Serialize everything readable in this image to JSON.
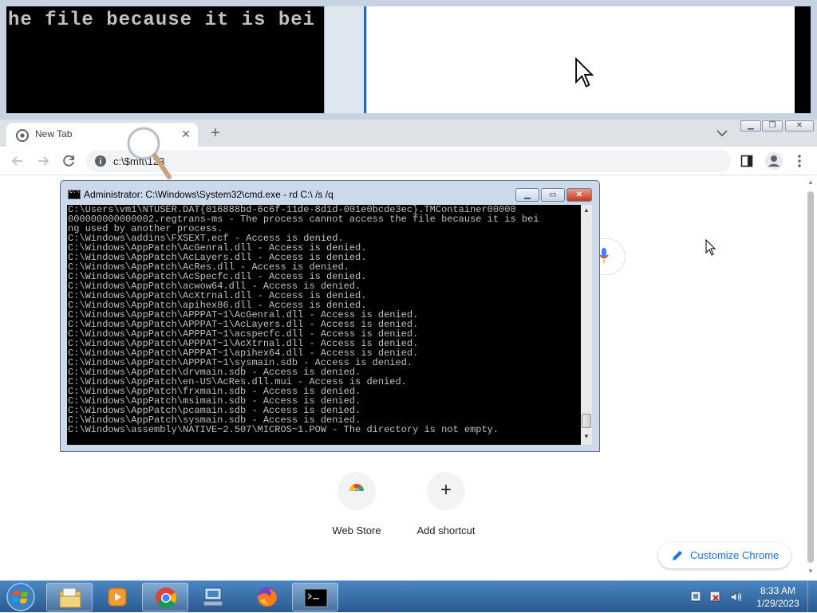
{
  "background_window": {
    "console_text": "he file because it is bei"
  },
  "chrome": {
    "tab_title": "New Tab",
    "address": "c:\\$mft\\123",
    "shortcuts": [
      {
        "label": "Web Store",
        "icon": "webstore-icon"
      },
      {
        "label": "Add shortcut",
        "icon": "add-icon"
      }
    ],
    "customize_label": "Customize Chrome",
    "accent_color": "#1a73e8"
  },
  "cmd": {
    "title": "Administrator: C:\\Windows\\System32\\cmd.exe - rd  C:\\ /s /q",
    "lines": [
      "C:\\Users\\vm1\\NTUSER.DAT{016888bd-6c6f-11de-8d1d-001e0bcde3ec}.TMContainer00000",
      "000000000000002.regtrans-ms - The process cannot access the file because it is bei",
      "ng used by another process.",
      "C:\\Windows\\addins\\FXSEXT.ecf - Access is denied.",
      "C:\\Windows\\AppPatch\\AcGenral.dll - Access is denied.",
      "C:\\Windows\\AppPatch\\AcLayers.dll - Access is denied.",
      "C:\\Windows\\AppPatch\\AcRes.dll - Access is denied.",
      "C:\\Windows\\AppPatch\\AcSpecfc.dll - Access is denied.",
      "C:\\Windows\\AppPatch\\acwow64.dll - Access is denied.",
      "C:\\Windows\\AppPatch\\AcXtrnal.dll - Access is denied.",
      "C:\\Windows\\AppPatch\\apihex86.dll - Access is denied.",
      "C:\\Windows\\AppPatch\\APPPAT~1\\AcGenral.dll - Access is denied.",
      "C:\\Windows\\AppPatch\\APPPAT~1\\AcLayers.dll - Access is denied.",
      "C:\\Windows\\AppPatch\\APPPAT~1\\acspecfc.dll - Access is denied.",
      "C:\\Windows\\AppPatch\\APPPAT~1\\AcXtrnal.dll - Access is denied.",
      "C:\\Windows\\AppPatch\\APPPAT~1\\apihex64.dll - Access is denied.",
      "C:\\Windows\\AppPatch\\APPPAT~1\\sysmain.sdb - Access is denied.",
      "C:\\Windows\\AppPatch\\drvmain.sdb - Access is denied.",
      "C:\\Windows\\AppPatch\\en-US\\AcRes.dll.mui - Access is denied.",
      "C:\\Windows\\AppPatch\\frxmain.sdb - Access is denied.",
      "C:\\Windows\\AppPatch\\msimain.sdb - Access is denied.",
      "C:\\Windows\\AppPatch\\pcamain.sdb - Access is denied.",
      "C:\\Windows\\AppPatch\\sysmain.sdb - Access is denied.",
      "C:\\Windows\\assembly\\NATIVE~2.507\\MICROS~1.POW - The directory is not empty."
    ]
  },
  "taskbar": {
    "apps": [
      {
        "name": "Windows Explorer",
        "icon": "folder-icon"
      },
      {
        "name": "Windows Media Player",
        "icon": "media-player-icon"
      },
      {
        "name": "Google Chrome",
        "icon": "chrome-icon"
      },
      {
        "name": "Network",
        "icon": "network-icon"
      },
      {
        "name": "Firefox",
        "icon": "firefox-icon"
      },
      {
        "name": "Command Prompt",
        "icon": "cmd-icon"
      }
    ],
    "time": "8:33 AM",
    "date": "1/29/2023"
  }
}
